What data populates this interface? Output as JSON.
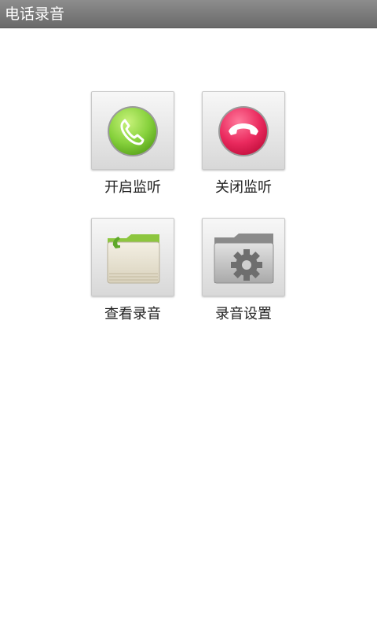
{
  "titlebar": {
    "title": "电话录音"
  },
  "menu": {
    "items": [
      {
        "label": "开启监听",
        "icon": "phone-answer-icon",
        "color": "#7ccf3a"
      },
      {
        "label": "关闭监听",
        "icon": "phone-hangup-icon",
        "color": "#e41e56"
      },
      {
        "label": "查看录音",
        "icon": "recordings-folder-icon",
        "color": "#8dc63f"
      },
      {
        "label": "录音设置",
        "icon": "settings-folder-icon",
        "color": "#7a7a7a"
      }
    ]
  }
}
